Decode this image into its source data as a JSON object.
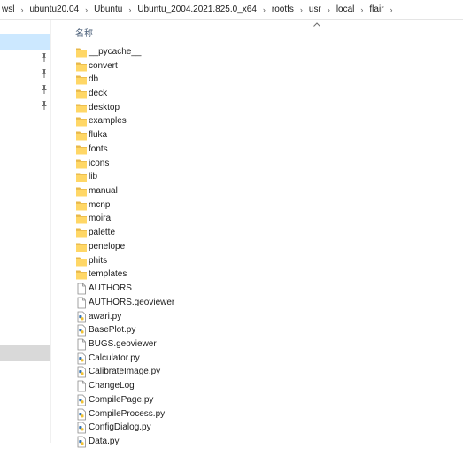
{
  "breadcrumb": [
    "wsl",
    "ubuntu20.04",
    "Ubuntu",
    "Ubuntu_2004.2021.825.0_x64",
    "rootfs",
    "usr",
    "local",
    "flair"
  ],
  "breadcrumb_separator": "›",
  "column_header": {
    "name_label": "名称",
    "sort_icon": "chevron-up-icon"
  },
  "nav": {
    "pin_icon": "pin-icon",
    "selected_color": "#cce8ff",
    "hover_color": "#d9d9d9"
  },
  "colors": {
    "folder": "#ffd766",
    "folder_back": "#e8b84a",
    "header_text": "#4c607a"
  },
  "files": [
    {
      "name": "__pycache__",
      "icon": "folder-icon"
    },
    {
      "name": "convert",
      "icon": "folder-icon"
    },
    {
      "name": "db",
      "icon": "folder-icon"
    },
    {
      "name": "deck",
      "icon": "folder-icon"
    },
    {
      "name": "desktop",
      "icon": "folder-icon"
    },
    {
      "name": "examples",
      "icon": "folder-icon"
    },
    {
      "name": "fluka",
      "icon": "folder-icon"
    },
    {
      "name": "fonts",
      "icon": "folder-icon"
    },
    {
      "name": "icons",
      "icon": "folder-icon"
    },
    {
      "name": "lib",
      "icon": "folder-icon"
    },
    {
      "name": "manual",
      "icon": "folder-icon"
    },
    {
      "name": "mcnp",
      "icon": "folder-icon"
    },
    {
      "name": "moira",
      "icon": "folder-icon"
    },
    {
      "name": "palette",
      "icon": "folder-icon"
    },
    {
      "name": "penelope",
      "icon": "folder-icon"
    },
    {
      "name": "phits",
      "icon": "folder-icon"
    },
    {
      "name": "templates",
      "icon": "folder-icon"
    },
    {
      "name": "AUTHORS",
      "icon": "file-icon"
    },
    {
      "name": "AUTHORS.geoviewer",
      "icon": "file-icon"
    },
    {
      "name": "awari.py",
      "icon": "python-file-icon"
    },
    {
      "name": "BasePlot.py",
      "icon": "python-file-icon"
    },
    {
      "name": "BUGS.geoviewer",
      "icon": "file-icon"
    },
    {
      "name": "Calculator.py",
      "icon": "python-file-icon"
    },
    {
      "name": "CalibrateImage.py",
      "icon": "python-file-icon"
    },
    {
      "name": "ChangeLog",
      "icon": "file-icon"
    },
    {
      "name": "CompilePage.py",
      "icon": "python-file-icon"
    },
    {
      "name": "CompileProcess.py",
      "icon": "python-file-icon"
    },
    {
      "name": "ConfigDialog.py",
      "icon": "python-file-icon"
    },
    {
      "name": "Data.py",
      "icon": "python-file-icon"
    }
  ]
}
